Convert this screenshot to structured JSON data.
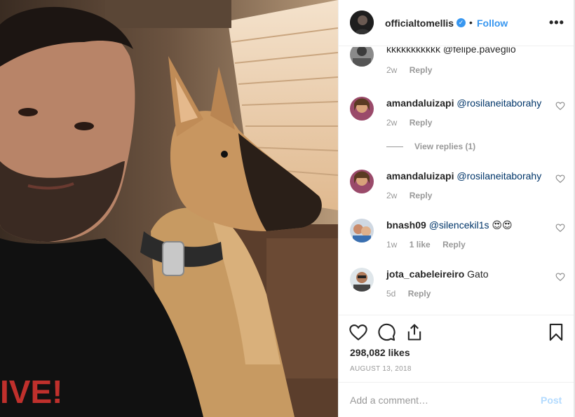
{
  "post": {
    "username": "officialtomellis",
    "separator": "•",
    "follow_label": "Follow",
    "more_label": "•••",
    "verified_glyph": "✓",
    "photo_shirt_text": "IVE!"
  },
  "comments": [
    {
      "user": "",
      "mention": "kkkkkkkkkkk @felipe.paveglio",
      "emoji": "",
      "age": "2w",
      "likes": "",
      "reply_label": "Reply"
    },
    {
      "user": "amandaluizapi",
      "mention": "@rosilaneitaborahy",
      "emoji": "",
      "age": "2w",
      "likes": "",
      "reply_label": "Reply"
    },
    {
      "user": "amandaluizapi",
      "mention": "@rosilaneitaborahy",
      "emoji": "",
      "age": "2w",
      "likes": "",
      "reply_label": "Reply"
    },
    {
      "user": "bnash09",
      "mention": "@silencekil1s",
      "emoji": "😍😍",
      "age": "1w",
      "likes": "1 like",
      "reply_label": "Reply"
    },
    {
      "user": "jota_cabeleireiro",
      "mention": "Gato",
      "emoji": "",
      "age": "5d",
      "likes": "",
      "reply_label": "Reply"
    }
  ],
  "view_replies_label": "View replies (1)",
  "likes_text": "298,082 likes",
  "date_text": "AUGUST 13, 2018",
  "add_comment": {
    "placeholder": "Add a comment…",
    "post_label": "Post"
  },
  "colors": {
    "accent": "#3897f0",
    "mention": "#003569",
    "muted": "#999999",
    "post_disabled": "#b3dbff"
  },
  "icons": [
    "heart-icon",
    "comment-icon",
    "share-icon",
    "bookmark-icon",
    "more-options-icon",
    "verified-badge-icon"
  ]
}
